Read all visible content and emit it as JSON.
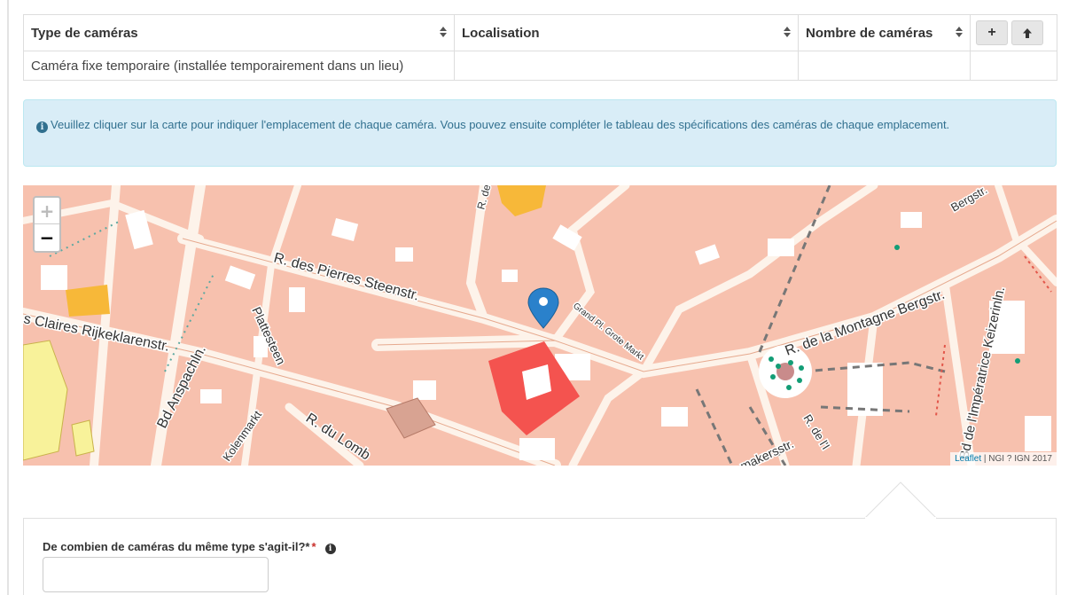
{
  "table": {
    "headers": {
      "type": "Type de caméras",
      "location": "Localisation",
      "count": "Nombre de caméras"
    },
    "buttons": {
      "add": "+",
      "up": "🡑"
    },
    "rows": [
      {
        "type": "Caméra fixe temporaire (installée temporairement dans un lieu)",
        "location": "",
        "count": ""
      }
    ]
  },
  "alert": {
    "icon": "info-circle-icon",
    "text": "Veuillez cliquer sur la carte pour indiquer l'emplacement de chaque caméra. Vous pouvez ensuite compléter le tableau des spécifications des caméras de chaque emplacement."
  },
  "map": {
    "zoom_in": "+",
    "zoom_out": "−",
    "attribution_link": "Leaflet",
    "attribution_text": " | NGI ? IGN 2017",
    "street_labels": [
      "R. des Pierres Steenstr.",
      "s Claires Rijkeklarenstr.",
      "Bd Anspachln.",
      "Plattesteen",
      "Kolenmarkt",
      "R. du Lomb",
      "Grand Pl. Grote Markt",
      "R. de la Montagne Bergstr.",
      "Bd de l'Impératrice Keizerinln.",
      "makersstr.",
      "R. de l'I",
      "R. de",
      "Bergstr."
    ],
    "colors": {
      "background": "#f7c1ae",
      "building": "#ffffff",
      "marker": "#2a81cb",
      "selected": "#f4534f",
      "park": "#f7b839",
      "green_dot": "#139d76"
    }
  },
  "form": {
    "label": "De combien de caméras du même type s'agit-il?*",
    "required_mark": "*",
    "help_icon": "info-icon",
    "value": ""
  }
}
